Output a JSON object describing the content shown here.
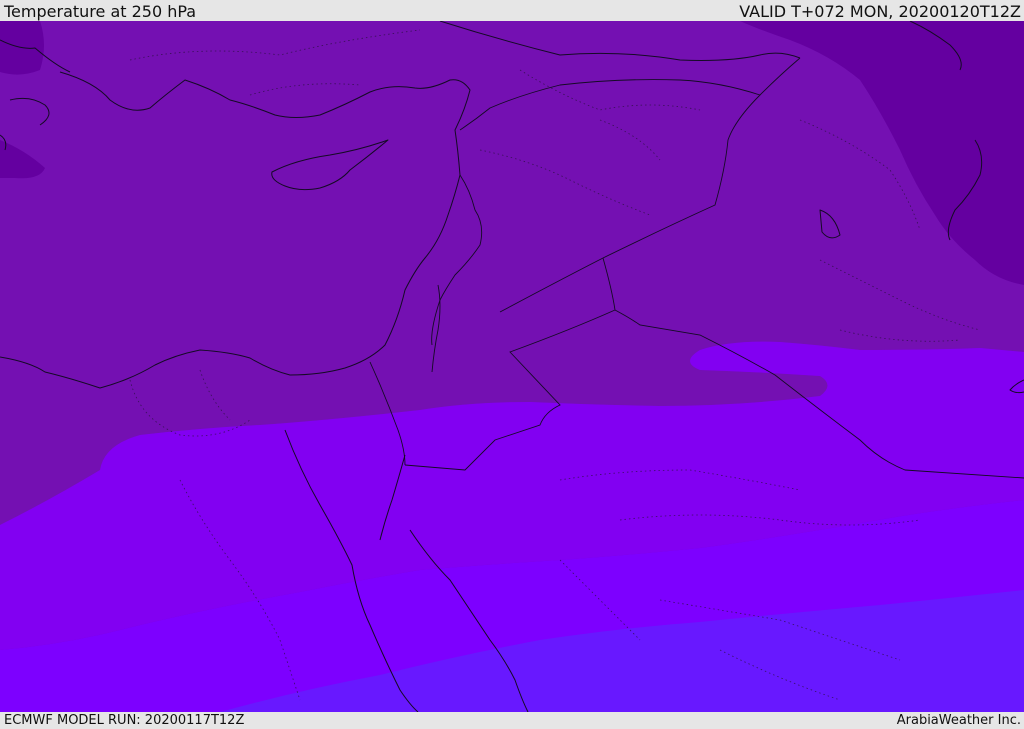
{
  "header": {
    "title": "Temperature at 250 hPa",
    "valid": "VALID T+072 MON, 20200120T12Z"
  },
  "footer": {
    "model_run": "ECMWF MODEL RUN: 20200117T12Z",
    "credit": "ArabiaWeather Inc."
  },
  "map": {
    "field_colors": {
      "darkest_northeast": "#6400a0",
      "dark_north": "#7410b2",
      "mid_dark": "#7e06c8",
      "violet_band": "#8200f2",
      "bright_violet": "#7d00ff",
      "blue_violet_south": "#6818ff"
    },
    "line_color": "#150a25"
  }
}
